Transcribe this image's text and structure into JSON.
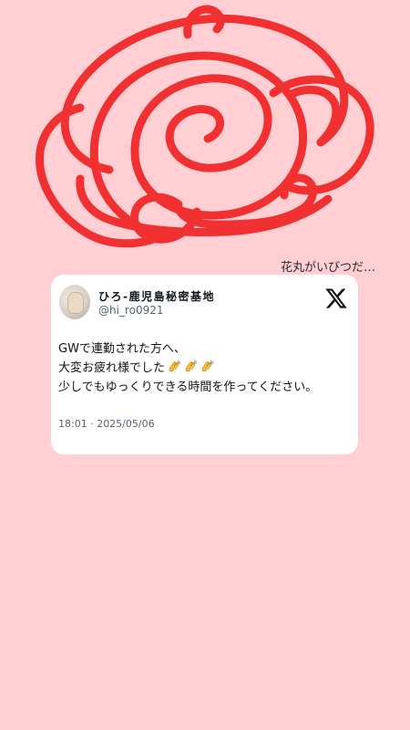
{
  "caption": "花丸がいびつだ…",
  "tweet": {
    "display_name": "ひろ-鹿児島秘密基地",
    "handle": "@hi_ro0921",
    "lines": [
      "GWで連勤された方へ、",
      "大変お疲れ様でした",
      "少しでもゆっくりできる時間を作ってください。"
    ],
    "emoji": "clapping-hands",
    "timestamp": "18:01 · 2025/05/06"
  },
  "colors": {
    "background": "#ffcfd3",
    "hanamaru": "#f02525",
    "card": "#ffffff",
    "text": "#0f1419",
    "muted": "#536471"
  }
}
